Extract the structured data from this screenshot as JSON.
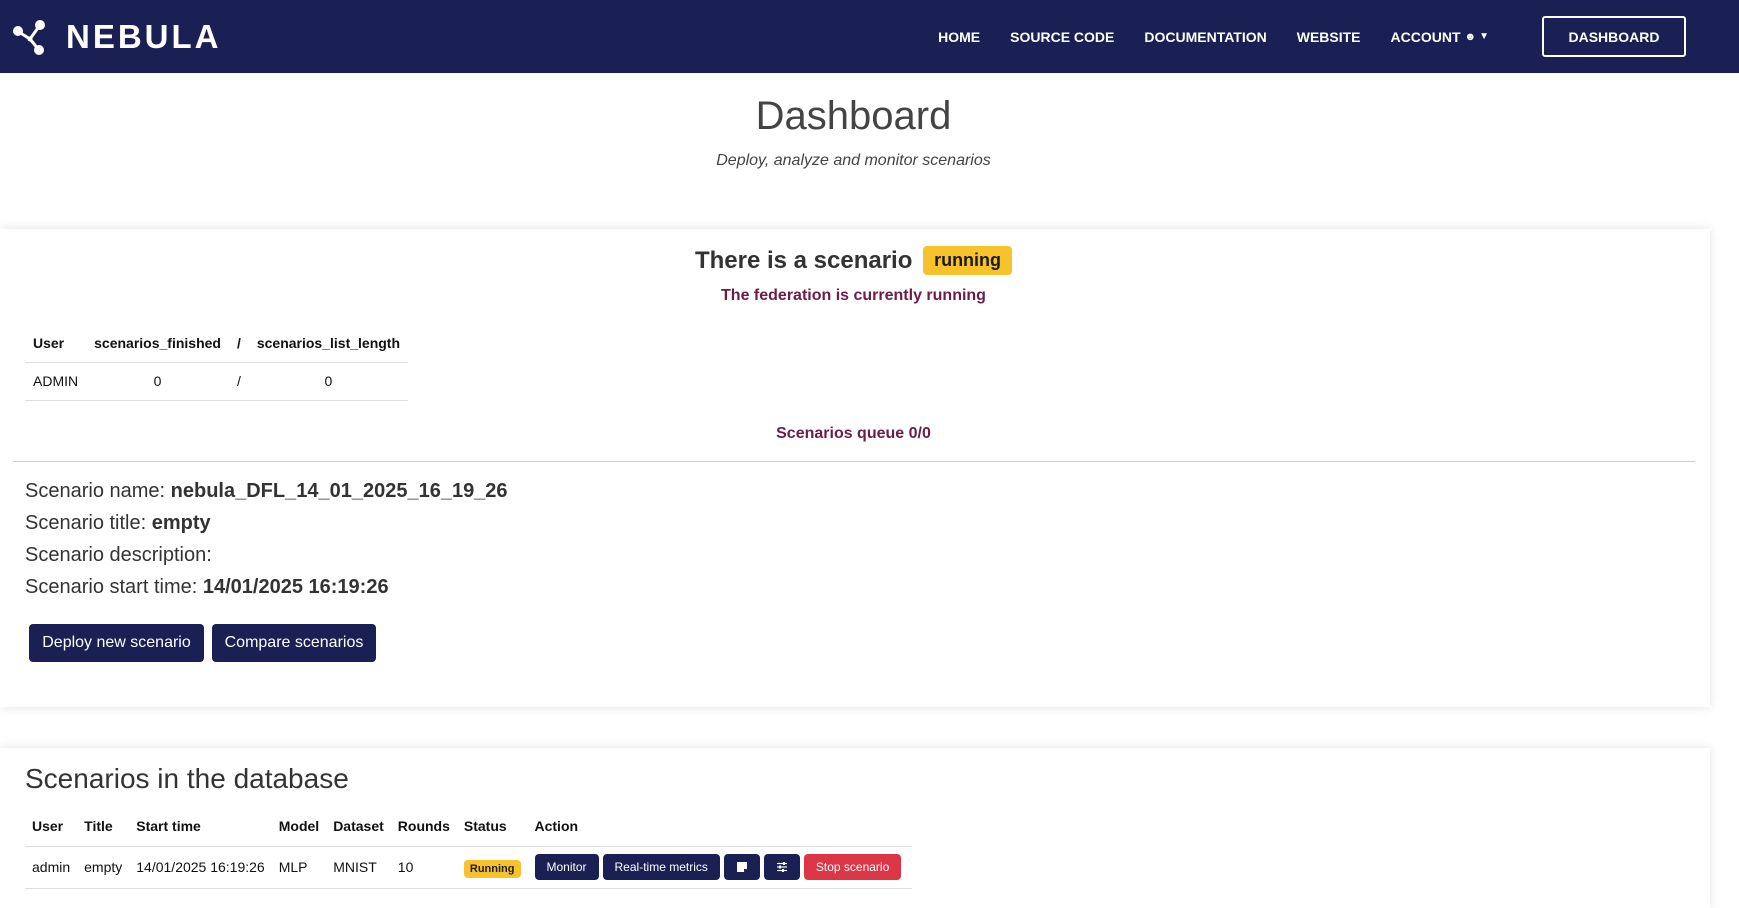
{
  "navbar": {
    "brand": "NEBULA",
    "links": [
      "HOME",
      "SOURCE CODE",
      "DOCUMENTATION",
      "WEBSITE"
    ],
    "account": "ACCOUNT",
    "dashboard_button": "DASHBOARD",
    "background": "#1a2053"
  },
  "header": {
    "title": "Dashboard",
    "subtitle": "Deploy, analyze and monitor scenarios"
  },
  "running_card": {
    "heading": "There is a scenario",
    "badge": "running",
    "federation_text": "The federation is currently running",
    "user_table": {
      "headers": [
        "User",
        "scenarios_finished",
        "/",
        "scenarios_list_length"
      ],
      "row": [
        "ADMIN",
        "0",
        "/",
        "0"
      ]
    },
    "queue_text": "Scenarios queue 0/0",
    "details": {
      "name_label": "Scenario name:",
      "name_value": "nebula_DFL_14_01_2025_16_19_26",
      "title_label": "Scenario title:",
      "title_value": "empty",
      "description_label": "Scenario description:",
      "description_value": "",
      "start_label": "Scenario start time:",
      "start_value": "14/01/2025 16:19:26"
    },
    "buttons": {
      "deploy": "Deploy new scenario",
      "compare": "Compare scenarios"
    }
  },
  "database_card": {
    "title": "Scenarios in the database",
    "headers": [
      "User",
      "Title",
      "Start time",
      "Model",
      "Dataset",
      "Rounds",
      "Status",
      "Action"
    ],
    "rows": [
      {
        "user": "admin",
        "title": "empty",
        "start_time": "14/01/2025 16:19:26",
        "model": "MLP",
        "dataset": "MNIST",
        "rounds": "10",
        "status": "Running",
        "actions": {
          "monitor": "Monitor",
          "metrics": "Real-time metrics",
          "notes_icon": "note-icon",
          "config_icon": "sliders-icon",
          "stop": "Stop scenario"
        }
      }
    ]
  },
  "colors": {
    "navy": "#1a2053",
    "badge_yellow": "#f7c22b",
    "accent_maroon": "#6b1d47",
    "danger": "#dc3545"
  }
}
